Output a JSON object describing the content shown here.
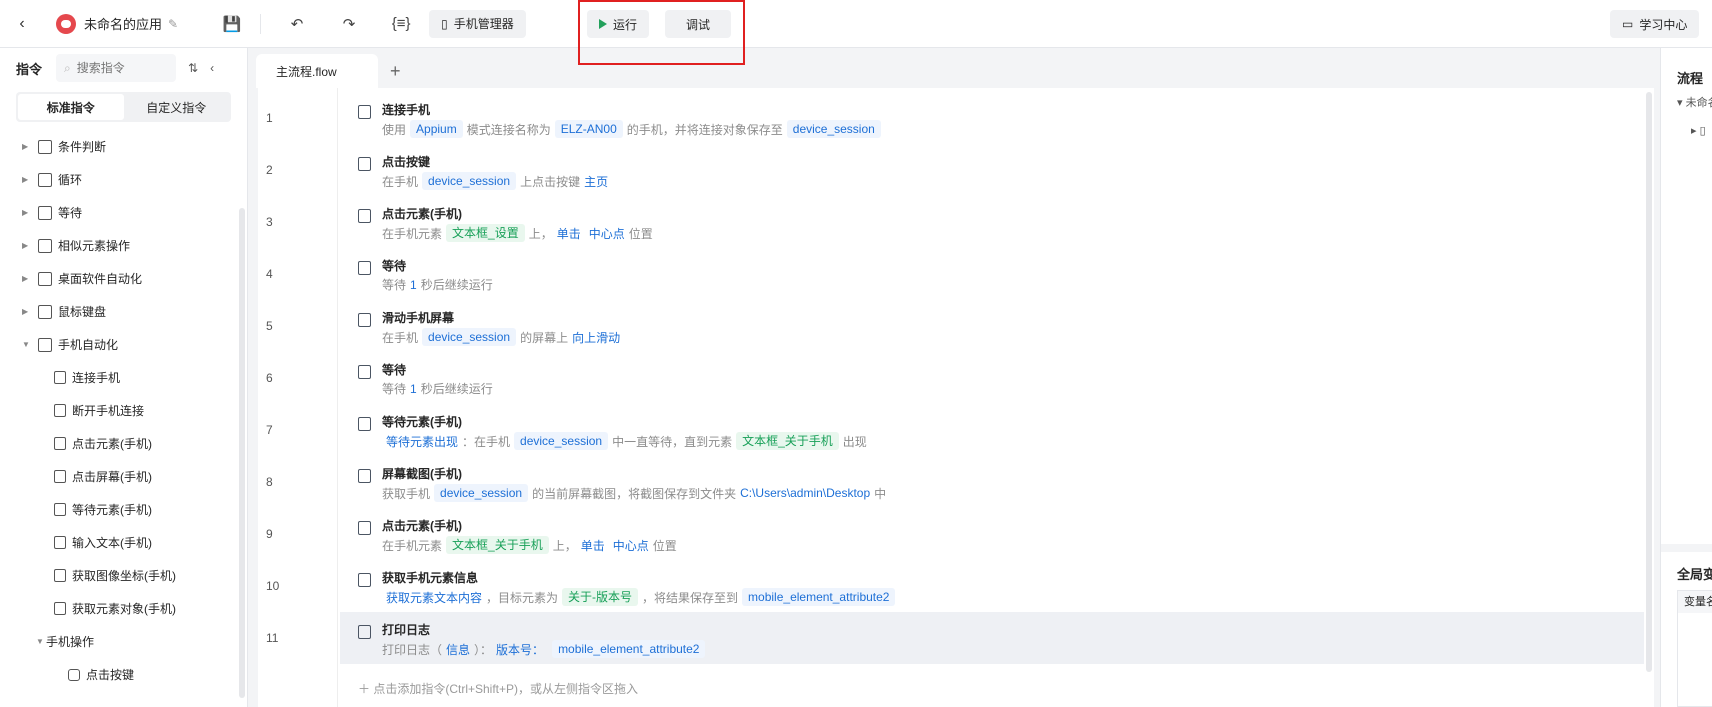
{
  "topbar": {
    "app_name": "未命名的应用",
    "phone_manager": "手机管理器",
    "run": "运行",
    "debug": "调试",
    "learn": "学习中心"
  },
  "sidebar": {
    "title": "指令",
    "search_placeholder": "搜索指令",
    "tabs": [
      "标准指令",
      "自定义指令"
    ],
    "groups": [
      {
        "label": "条件判断",
        "icon": "branch-icon"
      },
      {
        "label": "循环",
        "icon": "loop-icon"
      },
      {
        "label": "等待",
        "icon": "hourglass-icon"
      },
      {
        "label": "相似元素操作",
        "icon": "copy-icon"
      },
      {
        "label": "桌面软件自动化",
        "icon": "monitor-icon"
      },
      {
        "label": "鼠标键盘",
        "icon": "cursor-icon"
      },
      {
        "label": "手机自动化",
        "icon": "phone-icon"
      }
    ],
    "mobile_children": [
      "连接手机",
      "断开手机连接",
      "点击元素(手机)",
      "点击屏幕(手机)",
      "等待元素(手机)",
      "输入文本(手机)",
      "获取图像坐标(手机)",
      "获取元素对象(手机)"
    ],
    "sub_group": "手机操作",
    "sub_children": [
      "点击按键"
    ]
  },
  "tab": {
    "name": "主流程.flow"
  },
  "steps": [
    {
      "no": "1",
      "title": "连接手机",
      "icon": "phone-connect-icon",
      "desc": [
        {
          "t": "使用"
        },
        {
          "tag": "Appium"
        },
        {
          "t": "模式连接名称为"
        },
        {
          "tag": "ELZ-AN00"
        },
        {
          "t": "的手机，并将连接对象保存至"
        },
        {
          "tag": "device_session"
        }
      ]
    },
    {
      "no": "2",
      "title": "点击按键",
      "icon": "key-icon",
      "desc": [
        {
          "t": "在手机"
        },
        {
          "tag": "device_session"
        },
        {
          "t": "上点击按键"
        },
        {
          "link": "主页"
        }
      ]
    },
    {
      "no": "3",
      "title": "点击元素(手机)",
      "icon": "tap-element-icon",
      "desc": [
        {
          "t": "在手机元素"
        },
        {
          "gtag": "文本框_设置"
        },
        {
          "t": "上，"
        },
        {
          "link": "单击"
        },
        {
          "link": "中心点"
        },
        {
          "t": "位置"
        }
      ]
    },
    {
      "no": "4",
      "title": "等待",
      "icon": "hourglass-icon",
      "desc": [
        {
          "t": "等待"
        },
        {
          "link": "1"
        },
        {
          "t": "秒后继续运行"
        }
      ]
    },
    {
      "no": "5",
      "title": "滑动手机屏幕",
      "icon": "swipe-icon",
      "desc": [
        {
          "t": "在手机"
        },
        {
          "tag": "device_session"
        },
        {
          "t": "的屏幕上"
        },
        {
          "link": "向上滑动"
        }
      ]
    },
    {
      "no": "6",
      "title": "等待",
      "icon": "hourglass-icon",
      "desc": [
        {
          "t": "等待"
        },
        {
          "link": "1"
        },
        {
          "t": "秒后继续运行"
        }
      ]
    },
    {
      "no": "7",
      "title": "等待元素(手机)",
      "icon": "wait-element-icon",
      "desc": [
        {
          "link": "等待元素出现"
        },
        {
          "t": "：在手机"
        },
        {
          "tag": "device_session"
        },
        {
          "t": "中一直等待，直到元素"
        },
        {
          "gtag": "文本框_关于手机"
        },
        {
          "t": "出现"
        }
      ]
    },
    {
      "no": "8",
      "title": "屏幕截图(手机)",
      "icon": "screenshot-icon",
      "desc": [
        {
          "t": "获取手机"
        },
        {
          "tag": "device_session"
        },
        {
          "t": "的当前屏幕截图，将截图保存到文件夹"
        },
        {
          "link": "C:\\Users\\admin\\Desktop"
        },
        {
          "t": "中"
        }
      ]
    },
    {
      "no": "9",
      "title": "点击元素(手机)",
      "icon": "tap-element-icon",
      "desc": [
        {
          "t": "在手机元素"
        },
        {
          "gtag": "文本框_关于手机"
        },
        {
          "t": "上，"
        },
        {
          "link": "单击"
        },
        {
          "link": "中心点"
        },
        {
          "t": "位置"
        }
      ]
    },
    {
      "no": "10",
      "title": "获取手机元素信息",
      "icon": "element-info-icon",
      "desc": [
        {
          "link": "获取元素文本内容"
        },
        {
          "t": "，目标元素为"
        },
        {
          "gtag": "关于-版本号"
        },
        {
          "t": "，将结果保存至到"
        },
        {
          "tag": "mobile_element_attribute2"
        }
      ]
    },
    {
      "no": "11",
      "title": "打印日志",
      "icon": "print-icon",
      "desc": [
        {
          "t": "打印日志（"
        },
        {
          "link": "信息"
        },
        {
          "t": "）："
        },
        {
          "link": "版本号："
        },
        {
          "tag": "mobile_element_attribute2"
        }
      ]
    }
  ],
  "add_hint": "＋ 点击添加指令(Ctrl+Shift+P)，或从左侧指令区拖入",
  "right_panel": {
    "title": "流程",
    "item": "未命名",
    "title2": "全局变",
    "col": "变量名"
  }
}
